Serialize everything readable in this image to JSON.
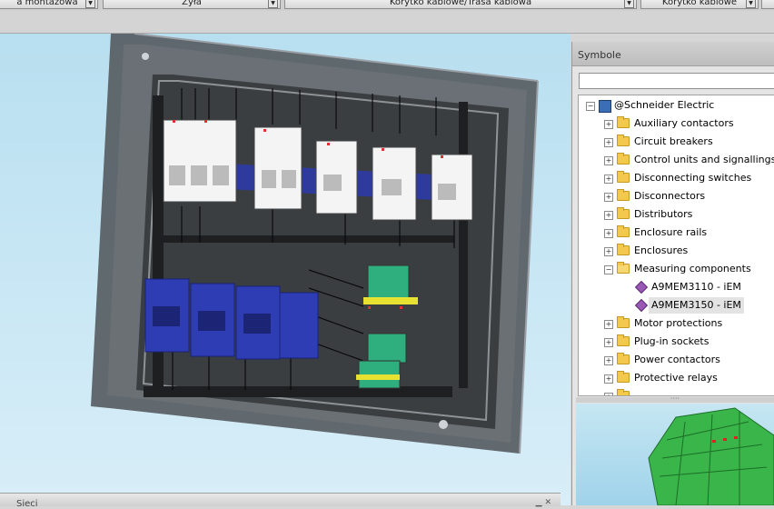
{
  "toolbar": {
    "combos": [
      {
        "label": "a montażowa"
      },
      {
        "label": "Żyła"
      },
      {
        "label": "Korytko kablowe/Trasa kablowa"
      },
      {
        "label": "Korytko kablowe"
      }
    ]
  },
  "symbole": {
    "title": "Symbole",
    "tree": {
      "root": "@Schneider Electric",
      "items": [
        {
          "label": "Auxiliary contactors",
          "expanded": false
        },
        {
          "label": "Circuit breakers",
          "expanded": false
        },
        {
          "label": "Control units and signallings",
          "expanded": false
        },
        {
          "label": "Disconnecting switches",
          "expanded": false
        },
        {
          "label": "Disconnectors",
          "expanded": false
        },
        {
          "label": "Distributors",
          "expanded": false
        },
        {
          "label": "Enclosure rails",
          "expanded": false
        },
        {
          "label": "Enclosures",
          "expanded": false
        },
        {
          "label": "Measuring components",
          "expanded": true,
          "children": [
            {
              "label": "A9MEM3110 - iEM"
            },
            {
              "label": "A9MEM3150 - iEM",
              "selected": true
            }
          ]
        },
        {
          "label": "Motor protections",
          "expanded": false
        },
        {
          "label": "Plug-in sockets",
          "expanded": false
        },
        {
          "label": "Power contactors",
          "expanded": false
        },
        {
          "label": "Protective relays",
          "expanded": false
        }
      ]
    }
  },
  "bottom_panel": {
    "title": "Sieci"
  },
  "icons": {
    "expander_collapsed": "plus-box-icon",
    "expander_expanded": "minus-box-icon",
    "folder": "folder-icon",
    "component": "component-gem-icon",
    "library": "library-icon"
  },
  "colors": {
    "viewport_bg": "#c4e6f4",
    "enclosure": "#5f5f5f",
    "breakers": "#f5f5f5",
    "contactors": "#2f3db5",
    "terminals": "#2fae7e",
    "preview_model": "#39b54a"
  }
}
